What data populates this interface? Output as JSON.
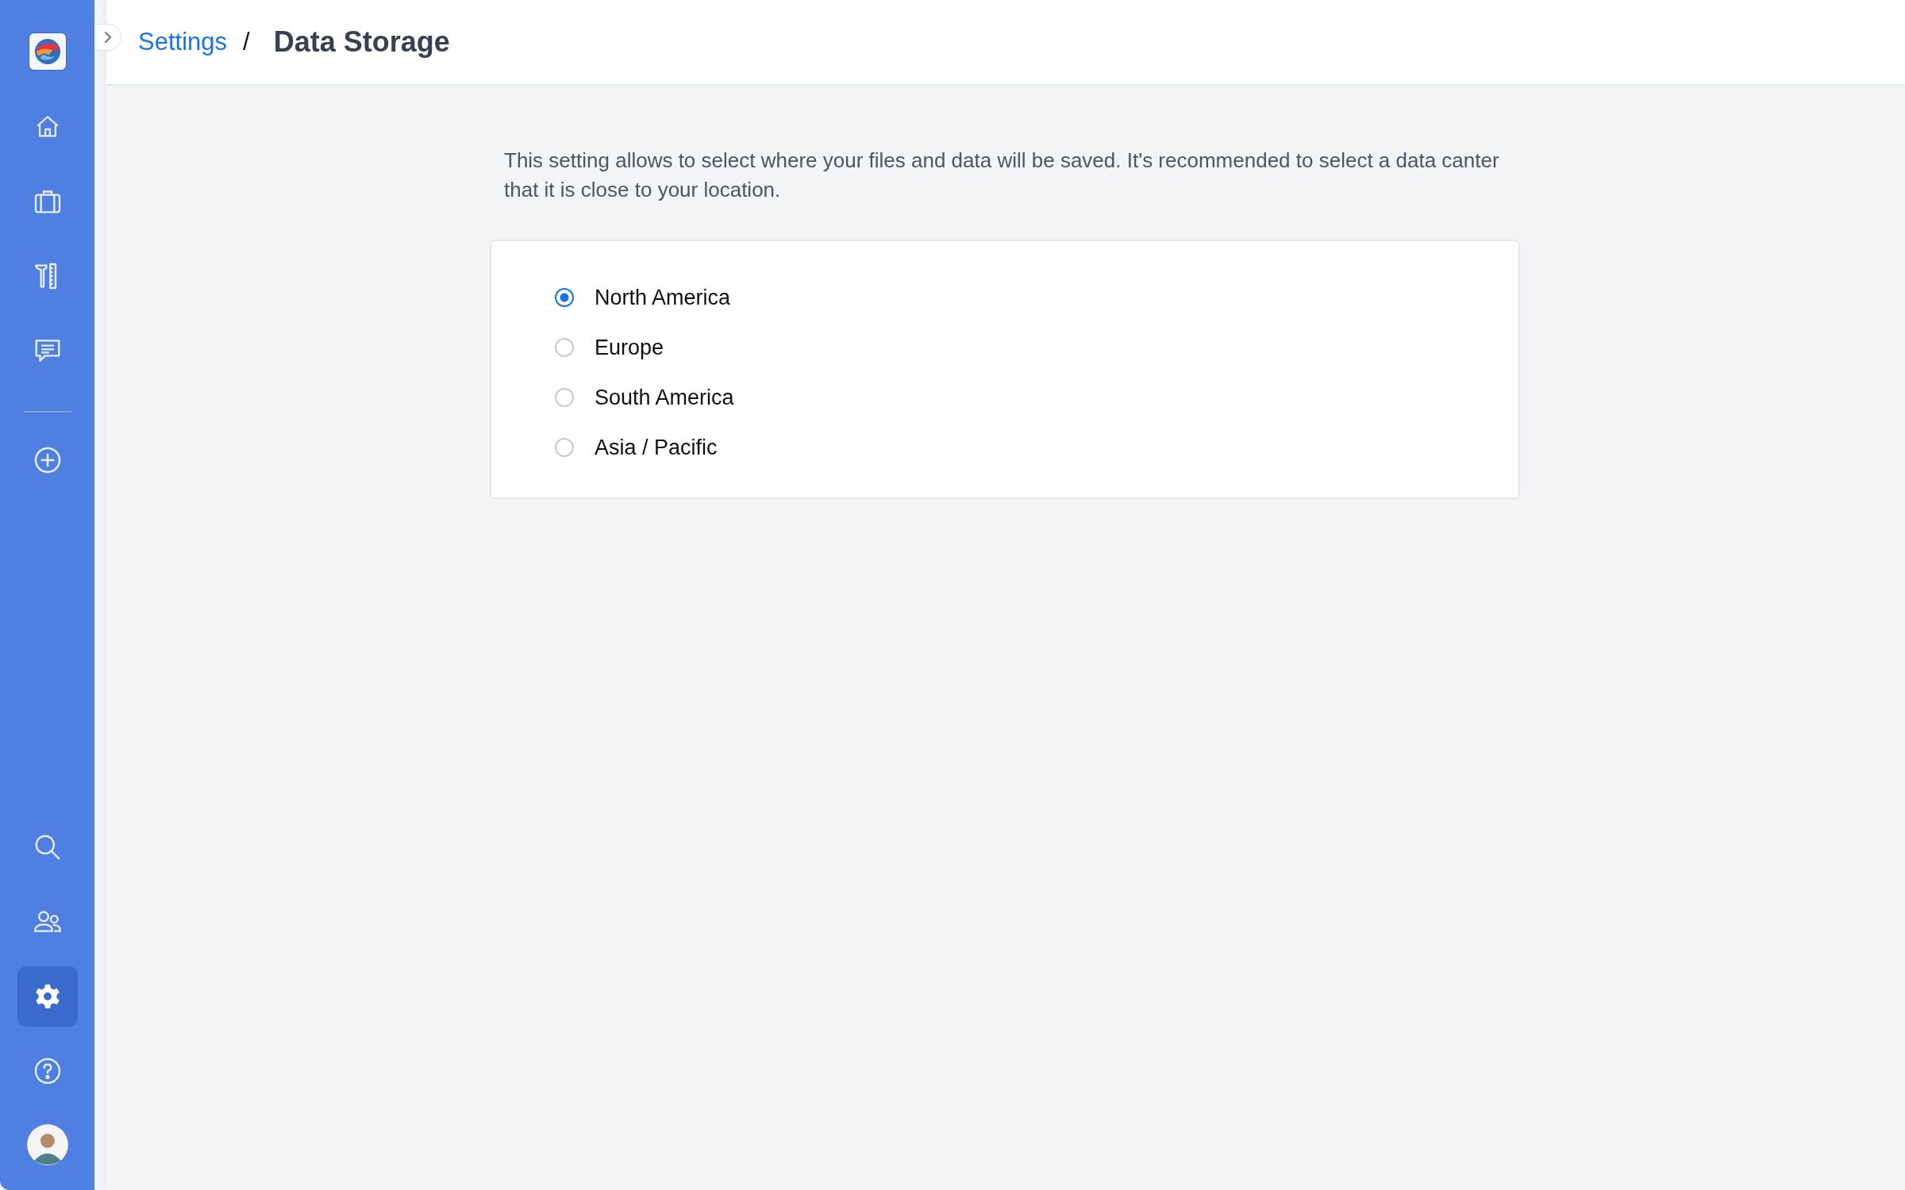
{
  "sidebar": {
    "top_items": [
      {
        "kind": "home",
        "selected": false
      },
      {
        "kind": "briefcase",
        "selected": false
      },
      {
        "kind": "tools",
        "selected": false
      },
      {
        "kind": "chat",
        "selected": false
      }
    ],
    "add_item": {
      "kind": "plus",
      "selected": false
    },
    "bottom_items": [
      {
        "kind": "search",
        "selected": false
      },
      {
        "kind": "users",
        "selected": false
      },
      {
        "kind": "settings",
        "selected": true
      },
      {
        "kind": "help",
        "selected": false
      }
    ]
  },
  "breadcrumb": {
    "parent": "Settings",
    "separator": "/",
    "current": "Data Storage"
  },
  "description": "This setting allows to select where your files and data will be saved. It's recommended to select a data canter that it is close to your location.",
  "regions": [
    {
      "label": "North America",
      "selected": true
    },
    {
      "label": "Europe",
      "selected": false
    },
    {
      "label": "South America",
      "selected": false
    },
    {
      "label": "Asia / Pacific",
      "selected": false
    }
  ]
}
